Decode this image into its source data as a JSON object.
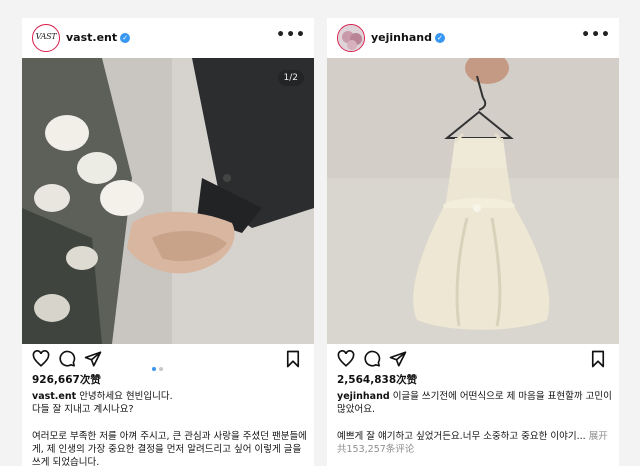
{
  "posts": [
    {
      "username": "vast.ent",
      "avatar_logo": "VAST",
      "more": "•••",
      "counter": "1/2",
      "likes": "926,667次赞",
      "caption_user": "vast.ent",
      "caption_line1": "안녕하세요 현빈입니다.",
      "caption_line2": "다들 잘 지내고 계시나요?",
      "body_line1": "여러모로 부족한 저를 아껴 주시고, 큰 관심과 사랑을 주셨던 팬분들에",
      "body_line2": "게, 제 인생의 가장 중요한 결정을 먼저 알려드리고 싶어 이렇게 글을",
      "body_line3": "쓰게 되었습니다."
    },
    {
      "username": "yejinhand",
      "more": "•••",
      "likes": "2,564,838次赞",
      "caption_user": "yejinhand",
      "caption_line1": "이글을 쓰기전에 어떤식으로 제 마음을 표현할까 고민이",
      "caption_line2": "많았어요.",
      "body_line1": "예쁘게 잘 얘기하고 싶었거든요.너무 소중하고 중요한 이야기...",
      "expand": "展开",
      "comments": "共153,257条评论"
    }
  ],
  "icons": [
    "heart-icon",
    "comment-icon",
    "share-icon",
    "bookmark-icon",
    "verified-icon",
    "more-icon"
  ],
  "colors": {
    "verified": "#3897f0",
    "active_dot": "#3897f0",
    "muted": "#8e8e8e"
  }
}
